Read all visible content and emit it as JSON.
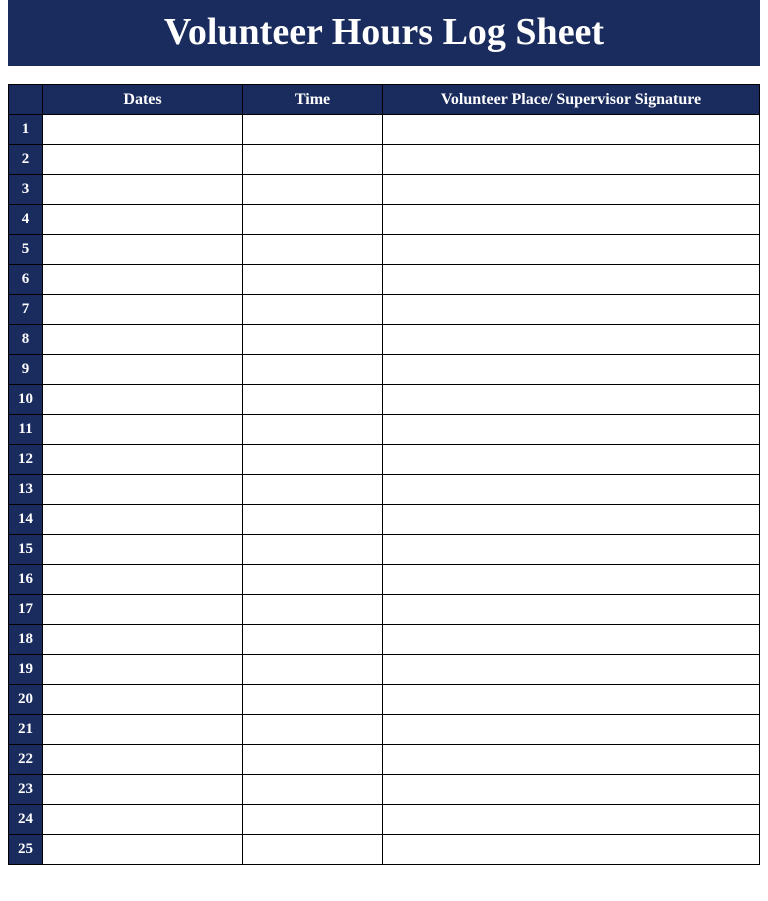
{
  "title": "Volunteer Hours Log Sheet",
  "columns": {
    "dates": "Dates",
    "time": "Time",
    "signature": "Volunteer Place/ Supervisor Signature"
  },
  "rows": [
    {
      "num": "1",
      "dates": "",
      "time": "",
      "signature": ""
    },
    {
      "num": "2",
      "dates": "",
      "time": "",
      "signature": ""
    },
    {
      "num": "3",
      "dates": "",
      "time": "",
      "signature": ""
    },
    {
      "num": "4",
      "dates": "",
      "time": "",
      "signature": ""
    },
    {
      "num": "5",
      "dates": "",
      "time": "",
      "signature": ""
    },
    {
      "num": "6",
      "dates": "",
      "time": "",
      "signature": ""
    },
    {
      "num": "7",
      "dates": "",
      "time": "",
      "signature": ""
    },
    {
      "num": "8",
      "dates": "",
      "time": "",
      "signature": ""
    },
    {
      "num": "9",
      "dates": "",
      "time": "",
      "signature": ""
    },
    {
      "num": "10",
      "dates": "",
      "time": "",
      "signature": ""
    },
    {
      "num": "11",
      "dates": "",
      "time": "",
      "signature": ""
    },
    {
      "num": "12",
      "dates": "",
      "time": "",
      "signature": ""
    },
    {
      "num": "13",
      "dates": "",
      "time": "",
      "signature": ""
    },
    {
      "num": "14",
      "dates": "",
      "time": "",
      "signature": ""
    },
    {
      "num": "15",
      "dates": "",
      "time": "",
      "signature": ""
    },
    {
      "num": "16",
      "dates": "",
      "time": "",
      "signature": ""
    },
    {
      "num": "17",
      "dates": "",
      "time": "",
      "signature": ""
    },
    {
      "num": "18",
      "dates": "",
      "time": "",
      "signature": ""
    },
    {
      "num": "19",
      "dates": "",
      "time": "",
      "signature": ""
    },
    {
      "num": "20",
      "dates": "",
      "time": "",
      "signature": ""
    },
    {
      "num": "21",
      "dates": "",
      "time": "",
      "signature": ""
    },
    {
      "num": "22",
      "dates": "",
      "time": "",
      "signature": ""
    },
    {
      "num": "23",
      "dates": "",
      "time": "",
      "signature": ""
    },
    {
      "num": "24",
      "dates": "",
      "time": "",
      "signature": ""
    },
    {
      "num": "25",
      "dates": "",
      "time": "",
      "signature": ""
    }
  ]
}
